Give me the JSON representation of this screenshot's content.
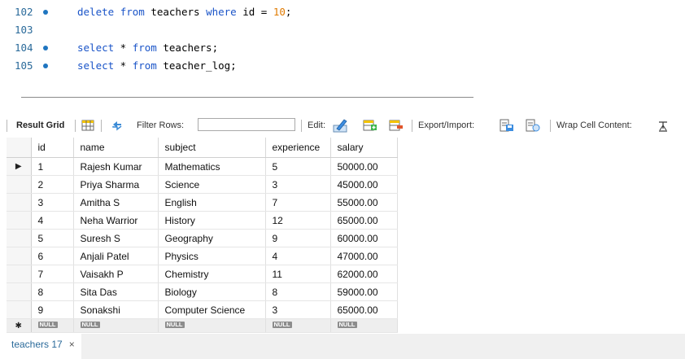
{
  "editor": {
    "lines": [
      {
        "number": "102",
        "has_dot": true,
        "tokens": [
          {
            "t": "kw",
            "v": "delete"
          },
          {
            "t": "tx",
            "v": " "
          },
          {
            "t": "kw",
            "v": "from"
          },
          {
            "t": "tx",
            "v": " teachers "
          },
          {
            "t": "kw",
            "v": "where"
          },
          {
            "t": "tx",
            "v": " id = "
          },
          {
            "t": "num",
            "v": "10"
          },
          {
            "t": "tx",
            "v": ";"
          }
        ]
      },
      {
        "number": "103",
        "has_dot": false,
        "tokens": []
      },
      {
        "number": "104",
        "has_dot": true,
        "tokens": [
          {
            "t": "kw",
            "v": "select"
          },
          {
            "t": "tx",
            "v": " * "
          },
          {
            "t": "kw",
            "v": "from"
          },
          {
            "t": "tx",
            "v": " teachers;"
          }
        ]
      },
      {
        "number": "105",
        "has_dot": true,
        "tokens": [
          {
            "t": "kw",
            "v": "select"
          },
          {
            "t": "tx",
            "v": " * "
          },
          {
            "t": "kw",
            "v": "from"
          },
          {
            "t": "tx",
            "v": " teacher_log;"
          }
        ]
      }
    ]
  },
  "toolbar": {
    "result_grid_label": "Result Grid",
    "filter_rows_label": "Filter Rows:",
    "filter_value": "",
    "edit_label": "Edit:",
    "export_label": "Export/Import:",
    "wrap_label": "Wrap Cell Content:"
  },
  "grid": {
    "columns": [
      "id",
      "name",
      "subject",
      "experience",
      "salary"
    ],
    "rows": [
      [
        "1",
        "Rajesh Kumar",
        "Mathematics",
        "5",
        "50000.00"
      ],
      [
        "2",
        "Priya Sharma",
        "Science",
        "3",
        "45000.00"
      ],
      [
        "3",
        "Amitha S",
        "English",
        "7",
        "55000.00"
      ],
      [
        "4",
        "Neha Warrior",
        "History",
        "12",
        "65000.00"
      ],
      [
        "5",
        "Suresh S",
        "Geography",
        "9",
        "60000.00"
      ],
      [
        "6",
        "Anjali Patel",
        "Physics",
        "4",
        "47000.00"
      ],
      [
        "7",
        "Vaisakh P",
        "Chemistry",
        "11",
        "62000.00"
      ],
      [
        "8",
        "Sita Das",
        "Biology",
        "8",
        "59000.00"
      ],
      [
        "9",
        "Sonakshi",
        "Computer Science",
        "3",
        "65000.00"
      ]
    ],
    "selected_marker": "▶",
    "new_row_marker": "✱",
    "null_label": "NULL"
  },
  "tabs": [
    {
      "label": "teachers 17",
      "close": "×"
    }
  ]
}
